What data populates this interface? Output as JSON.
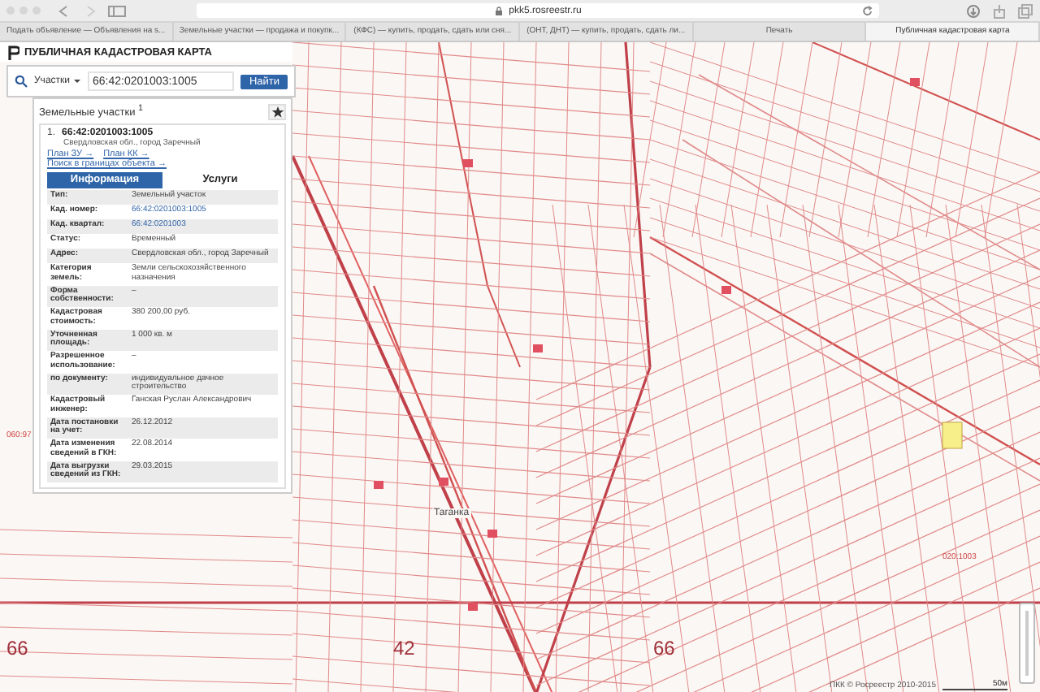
{
  "browser": {
    "url": "pkk5.rosreestr.ru",
    "tabs": [
      {
        "label": "Подать объявление — Объявления на s...",
        "selected": false
      },
      {
        "label": "Земельные участки — продажа и покупк...",
        "selected": false
      },
      {
        "label": "(КФС) — купить, продать, сдать или сня...",
        "selected": false
      },
      {
        "label": "(ОНТ, ДНТ) — купить, продать, сдать ли...",
        "selected": false
      },
      {
        "label": "Печать",
        "selected": false
      },
      {
        "label": "Публичная кадастровая карта",
        "selected": true
      }
    ]
  },
  "app_title": "ПУБЛИЧНАЯ КАДАСТРОВАЯ КАРТА",
  "search": {
    "type": "Участки",
    "value": "66:42:0201003:1005",
    "button": "Найти"
  },
  "results": {
    "heading": "Земельные участки $^{1}$",
    "item": {
      "index": "1.",
      "number": "66:42:0201003:1005",
      "address": "Свердловская обл., город Заречный",
      "links": [
        "План ЗУ →",
        "План КК →",
        "Поиск в границах объекта →"
      ],
      "tabs": [
        {
          "label": "Информация",
          "selected": true
        },
        {
          "label": "Услуги",
          "selected": false
        }
      ],
      "rows": [
        {
          "label": "Тип:",
          "value": "Земельный участок",
          "link": false
        },
        {
          "label": "Кад. номер:",
          "value": "66:42:0201003:1005",
          "link": true
        },
        {
          "label": "Кад. квартал:",
          "value": "66:42:0201003",
          "link": true
        },
        {
          "label": "Статус:",
          "value": "Временный",
          "link": false
        },
        {
          "label": "Адрес:",
          "value": "Свердловская обл., город Заречный",
          "link": false
        },
        {
          "label": "Категория земель:",
          "value": "Земли сельскохозяйственного назначения",
          "link": false
        },
        {
          "label": "Форма собственности:",
          "value": "–",
          "link": false
        },
        {
          "label": "Кадастровая стоимость:",
          "value": "380 200,00 руб.",
          "link": false
        },
        {
          "label": "Уточненная площадь:",
          "value": "1 000 кв. м",
          "link": false
        },
        {
          "label": "Разрешенное использование:",
          "value": "–",
          "link": false
        },
        {
          "label": "по документу:",
          "value": "индивидуальное дачное строительство",
          "link": false
        },
        {
          "label": "Кадастровый инженер:",
          "value": "Ганская Руслан Александрович",
          "link": false
        },
        {
          "label": "Дата постановки на учет:",
          "value": "26.12.2012",
          "link": false
        },
        {
          "label": "Дата изменения сведений в ГКН:",
          "value": "22.08.2014",
          "link": false
        },
        {
          "label": "Дата выгрузки сведений из ГКН:",
          "value": "29.03.2015",
          "link": false
        }
      ]
    }
  },
  "map": {
    "labels": [
      {
        "text": "Таганка",
        "kind": "place"
      },
      {
        "text": "060:97",
        "kind": "block"
      },
      {
        "text": "66",
        "kind": "region"
      },
      {
        "text": "42",
        "kind": "region"
      },
      {
        "text": "66",
        "kind": "region"
      },
      {
        "text": "020:1003",
        "kind": "block"
      }
    ],
    "copyright": "ПКК © Росреестр 2010-2015",
    "scale": "50м"
  }
}
